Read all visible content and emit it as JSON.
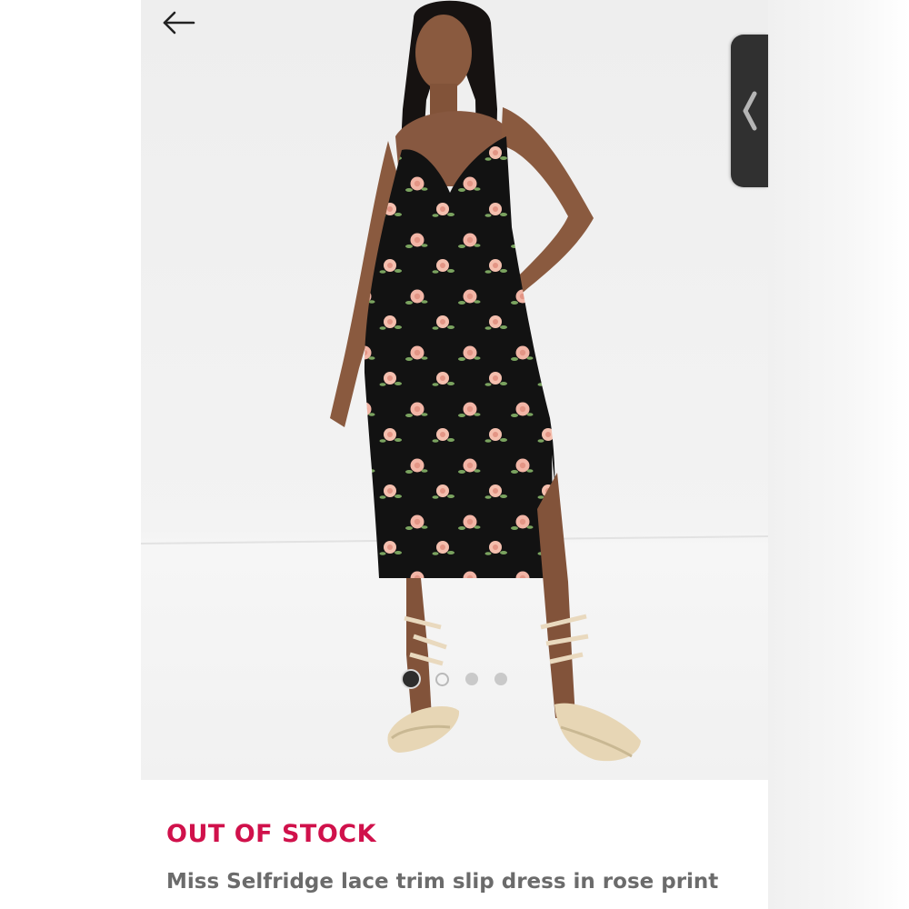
{
  "product": {
    "stock_status": "OUT OF STOCK",
    "title": "Miss Selfridge lace trim slip dress in rose print"
  },
  "navigation": {
    "back_icon": "arrow-left-icon"
  },
  "gallery": {
    "image_count": 4,
    "active_index": 0
  },
  "edge_panel": {
    "icon": "chevron-left-icon"
  },
  "colors": {
    "stock_status": "#d0114b",
    "title": "#6b6b6b",
    "dress": "#111111",
    "rose": "#f2b5a6",
    "leaf": "#7aa35f"
  }
}
